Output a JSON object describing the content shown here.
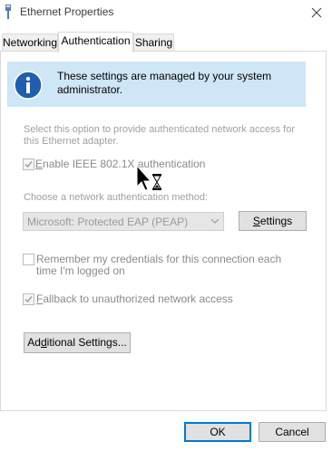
{
  "window": {
    "title": "Ethernet Properties",
    "icon": "network-adapter-icon",
    "close_icon": "close-icon"
  },
  "tabs": [
    {
      "label": "Networking",
      "active": false
    },
    {
      "label": "Authentication",
      "active": true
    },
    {
      "label": "Sharing",
      "active": false
    }
  ],
  "info_banner": {
    "icon": "info-icon",
    "text_line1": "These settings are managed by your system",
    "text_line2": "administrator."
  },
  "description": {
    "line1": "Select this option to provide authenticated network access for",
    "line2": "this Ethernet adapter."
  },
  "enable_8021x": {
    "label": "Enable IEEE 802.1X authentication",
    "checked": true,
    "enabled": false
  },
  "method": {
    "label": "Choose a network authentication method:",
    "selected": "Microsoft: Protected EAP (PEAP)",
    "enabled": false
  },
  "settings_button": {
    "label": "Settings"
  },
  "remember_credentials": {
    "label_line1": "Remember my credentials for this connection each",
    "label_line2": "time I'm logged on",
    "checked": false,
    "enabled": false
  },
  "fallback": {
    "label": "Fallback to unauthorized network access",
    "checked": true,
    "enabled": false
  },
  "additional_settings_button": {
    "label": "Additional Settings..."
  },
  "footer": {
    "ok_label": "OK",
    "cancel_label": "Cancel"
  },
  "cursor": {
    "type": "busy-pointer"
  }
}
